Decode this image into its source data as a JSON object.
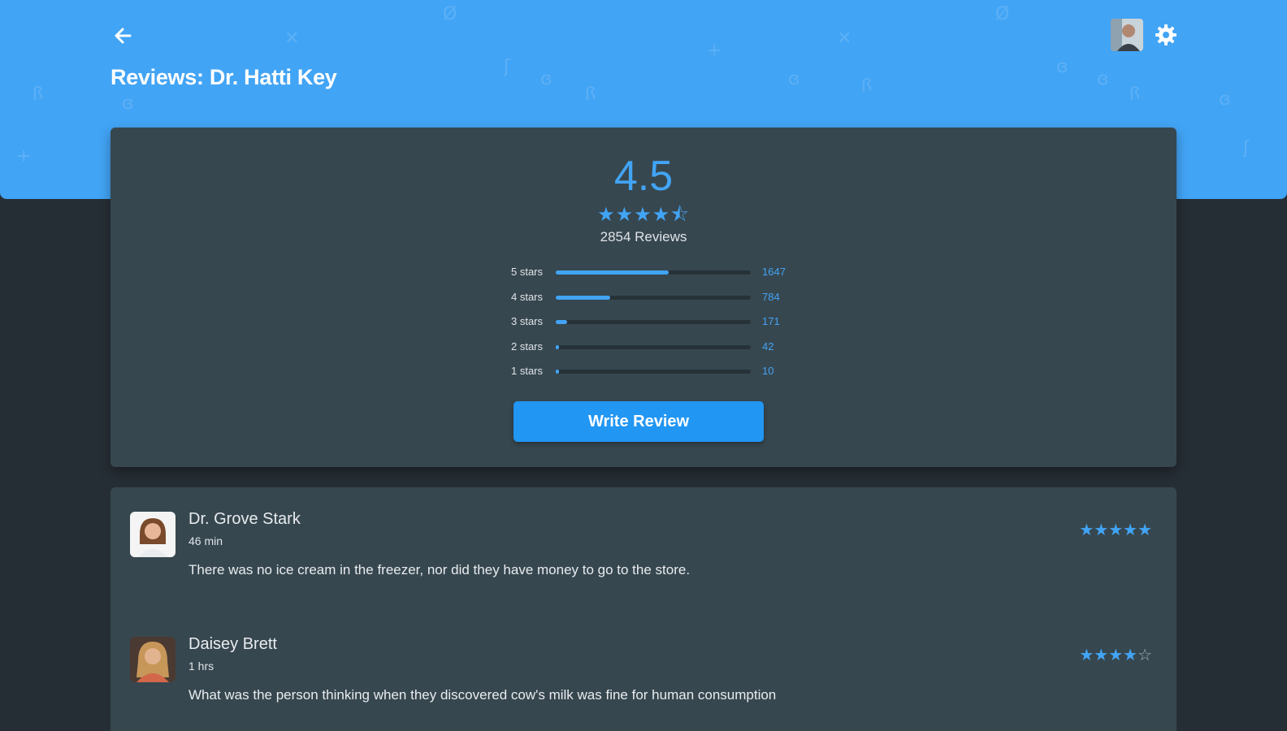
{
  "header": {
    "title": "Reviews: Dr. Hatti Key",
    "back_icon": "arrow-left-icon",
    "settings_icon": "gear-icon",
    "accent_color": "#42a4f5"
  },
  "summary": {
    "average": "4.5",
    "average_value": 4.5,
    "stars": "★★★★⯪",
    "total_reviews": "2854 Reviews",
    "distribution": [
      {
        "label": "5 stars",
        "count": "1647",
        "fraction": 0.58
      },
      {
        "label": "4 stars",
        "count": "784",
        "fraction": 0.28
      },
      {
        "label": "3 stars",
        "count": "171",
        "fraction": 0.06
      },
      {
        "label": "2 stars",
        "count": "42",
        "fraction": 0.015
      },
      {
        "label": "1 stars",
        "count": "10",
        "fraction": 0.004
      }
    ],
    "write_review_label": "Write Review"
  },
  "reviews": [
    {
      "name": "Dr. Grove Stark",
      "time": "46 min",
      "text": "There was no ice cream in the freezer, nor did they have money to go to the store.",
      "rating": 5,
      "stars_filled": "★★★★★",
      "stars_empty": ""
    },
    {
      "name": "Daisey Brett",
      "time": "1 hrs",
      "text": "What was the person thinking when they discovered cow's milk was fine for human consumption",
      "rating": 4,
      "stars_filled": "★★★★",
      "stars_empty": "☆"
    }
  ]
}
